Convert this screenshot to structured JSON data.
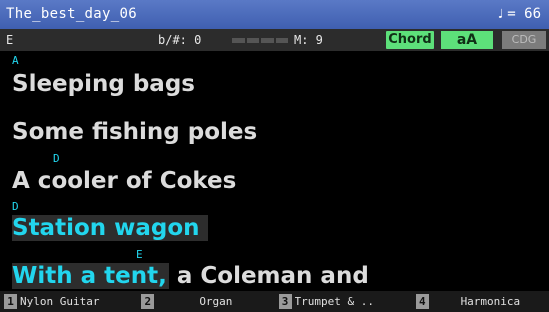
{
  "header": {
    "title": "The_best_day_06",
    "tempo": "= 66",
    "tempo_icon": "quarter-note-icon"
  },
  "status": {
    "key": "E",
    "flat_sharp": "b/#: 0",
    "measure": "M:  9",
    "chord_label": "Chord",
    "font_size_label": "aA",
    "cdg_label": "CDG"
  },
  "lyrics": {
    "lines": [
      {
        "chord": "A",
        "text": "Sleeping bags"
      },
      {
        "chord": "",
        "text": "Some fishing poles"
      },
      {
        "chord": "D",
        "text": "A cooler of Cokes"
      },
      {
        "chord": "D",
        "text": "Station wagon"
      },
      {
        "chord": "E",
        "text_current": "With a tent,",
        "text_rest": " a Coleman and"
      }
    ]
  },
  "tracks": [
    {
      "number": "1",
      "name": "Nylon Guitar"
    },
    {
      "number": "2",
      "name": "Organ"
    },
    {
      "number": "3",
      "name": "Trumpet & .."
    },
    {
      "number": "4",
      "name": "Harmonica"
    }
  ],
  "colors": {
    "title_bar": "#4a6ab8",
    "chord_button": "#5de07a",
    "current_lyric": "#22d6ee"
  }
}
